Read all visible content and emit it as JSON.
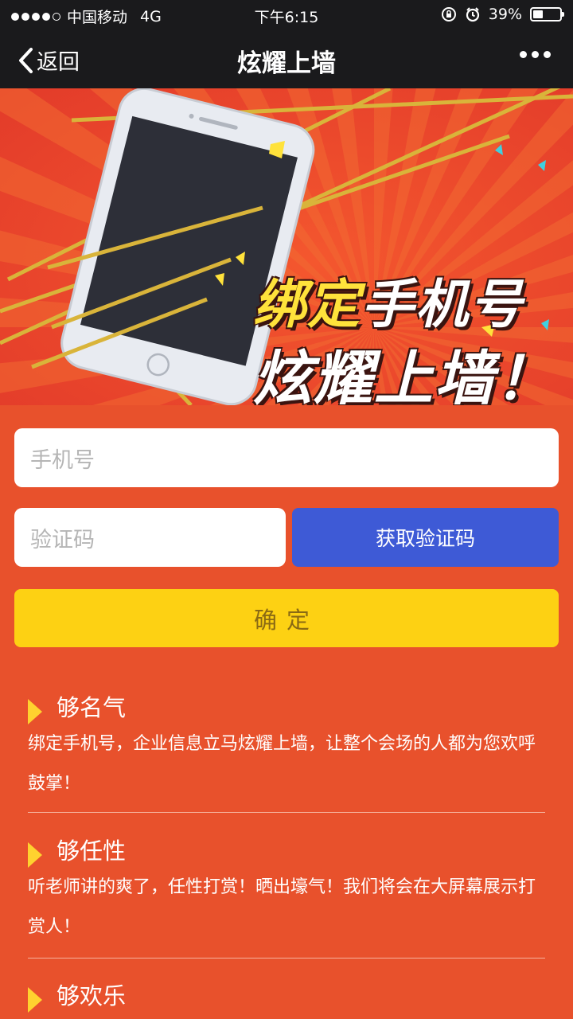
{
  "status_bar": {
    "carrier": "中国移动",
    "network": "4G",
    "time": "下午6:15",
    "battery_percent": "39%",
    "battery_level": 0.39,
    "icons": [
      "signal-dots-icon",
      "rotation-lock-icon",
      "alarm-icon",
      "battery-icon"
    ]
  },
  "nav": {
    "back_label": "返回",
    "title": "炫耀上墙",
    "icons": [
      "chevron-left-icon",
      "more-dots-icon"
    ]
  },
  "banner": {
    "line1_highlight": "绑定",
    "line1_rest": "手机号",
    "line2": "炫耀上墙！",
    "colors": {
      "background": "#e8412a",
      "rays": "#f26a32",
      "highlight": "#ffe23b"
    }
  },
  "form": {
    "phone_placeholder": "手机号",
    "code_placeholder": "验证码",
    "get_code_label": "获取验证码",
    "confirm_label": "确定"
  },
  "features": [
    {
      "title": "够名气",
      "body": "绑定手机号，企业信息立马炫耀上墙，让整个会场的人都为您欢呼鼓掌！"
    },
    {
      "title": "够任性",
      "body": "听老师讲的爽了，任性打赏！晒出壕气！我们将会在大屏幕展示打赏人！"
    },
    {
      "title": "够欢乐",
      "body": ""
    }
  ],
  "colors": {
    "page_bg": "#e8512c",
    "bar_bg": "#1a1a1c",
    "button_blue": "#3e5ad6",
    "button_yellow": "#fdd113",
    "bullet_yellow": "#ffd22f"
  }
}
